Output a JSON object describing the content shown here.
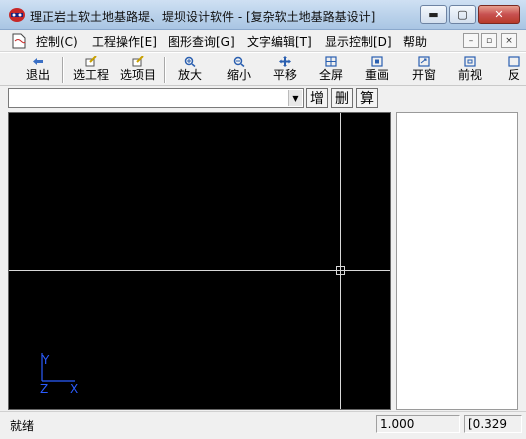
{
  "window": {
    "title": "理正岩土软土地基路堤、堤坝设计软件 - [复杂软土地基路基设计]",
    "minimize_label": "▬",
    "maximize_label": "▢",
    "close_label": "✕"
  },
  "menu": {
    "items": [
      {
        "label": "控制(C)"
      },
      {
        "label": "工程操作[E]"
      },
      {
        "label": "图形查询[G]"
      },
      {
        "label": "文字编辑[T]"
      },
      {
        "label": "显示控制[D]"
      },
      {
        "label": "帮助"
      }
    ],
    "mdi_min": "–",
    "mdi_restore": "▫",
    "mdi_close": "×"
  },
  "toolbar": {
    "buttons": [
      {
        "label": "退出",
        "icon": "back-arrow-icon"
      },
      {
        "label": "选工程",
        "icon": "select-project-icon"
      },
      {
        "label": "选项目",
        "icon": "select-item-icon"
      },
      {
        "label": "放大",
        "icon": "zoom-in-icon"
      },
      {
        "label": "缩小",
        "icon": "zoom-out-icon"
      },
      {
        "label": "平移",
        "icon": "pan-icon"
      },
      {
        "label": "全屏",
        "icon": "fullscreen-icon"
      },
      {
        "label": "重画",
        "icon": "redraw-icon"
      },
      {
        "label": "开窗",
        "icon": "window-icon"
      },
      {
        "label": "前视",
        "icon": "previous-view-icon"
      },
      {
        "label": "反",
        "icon": "reverse-icon"
      }
    ]
  },
  "command": {
    "combo_value": "",
    "add_label": "增",
    "delete_label": "删",
    "compute_label": "算"
  },
  "canvas": {
    "axis_y": "Y",
    "axis_z": "Z",
    "axis_x": "X"
  },
  "status": {
    "text": "就绪",
    "scale": "1.000",
    "coords": "[0.329"
  }
}
